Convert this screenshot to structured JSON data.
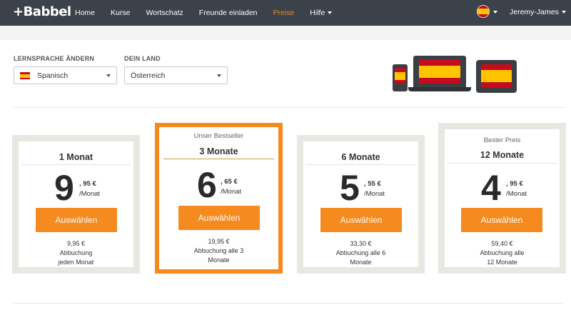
{
  "header": {
    "logo": "+Babbel",
    "nav": [
      {
        "label": "Home"
      },
      {
        "label": "Kurse"
      },
      {
        "label": "Wortschatz"
      },
      {
        "label": "Freunde einladen"
      },
      {
        "label": "Preise"
      },
      {
        "label": "Hilfe"
      }
    ],
    "user": "Jeremy-James",
    "active_color": "#f58a1f"
  },
  "filters": {
    "language_label": "LERNSPRACHE ÄNDERN",
    "language_value": "Spanisch",
    "country_label": "DEIN LAND",
    "country_value": "Österreich"
  },
  "plans": [
    {
      "tagline": "",
      "term": "1 Monat",
      "price_int": "9",
      "price_cents": ", 95 €",
      "per": "/Monat",
      "button": "Auswählen",
      "note_total": "9,95 €",
      "note_1": "Abbuchung",
      "note_2": "jeden Monat"
    },
    {
      "tagline": "Unser Bestseller",
      "term": "3 Monate",
      "price_int": "6",
      "price_cents": ", 65 €",
      "per": "/Monat",
      "button": "Auswählen",
      "note_total": "19,95 €",
      "note_1": "Abbuchung alle 3",
      "note_2": "Monate"
    },
    {
      "tagline": "",
      "term": "6 Monate",
      "price_int": "5",
      "price_cents": ", 55 €",
      "per": "/Monat",
      "button": "Auswählen",
      "note_total": "33,30 €",
      "note_1": "Abbuchung alle 6",
      "note_2": "Monate"
    },
    {
      "tagline": "Bester Preis",
      "term": "12 Monate",
      "price_int": "4",
      "price_cents": ", 95 €",
      "per": "/Monat",
      "button": "Auswählen",
      "note_total": "59,40 €",
      "note_1": "Abbuchung alle",
      "note_2": "12 Monate"
    }
  ],
  "colors": {
    "brand_orange": "#f58a1f",
    "nav_bg": "#3b4249"
  }
}
